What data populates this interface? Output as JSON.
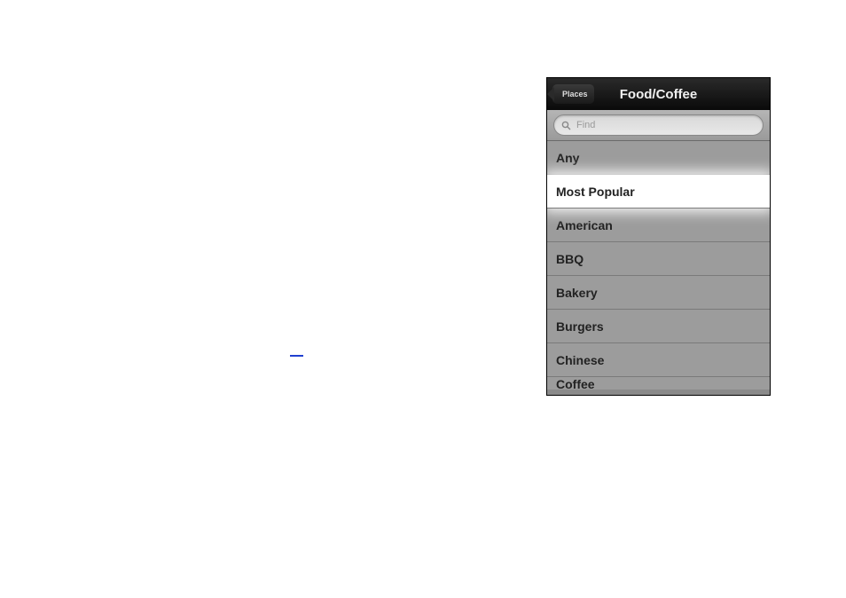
{
  "nav": {
    "back_label": "Places",
    "title": "Food/Coffee"
  },
  "search": {
    "placeholder": "Find",
    "value": ""
  },
  "categories": [
    {
      "label": "Any",
      "selected": false
    },
    {
      "label": "Most Popular",
      "selected": true
    },
    {
      "label": "American",
      "selected": false
    },
    {
      "label": "BBQ",
      "selected": false
    },
    {
      "label": "Bakery",
      "selected": false
    },
    {
      "label": "Burgers",
      "selected": false
    },
    {
      "label": "Chinese",
      "selected": false
    },
    {
      "label": "Coffee",
      "selected": false
    }
  ]
}
